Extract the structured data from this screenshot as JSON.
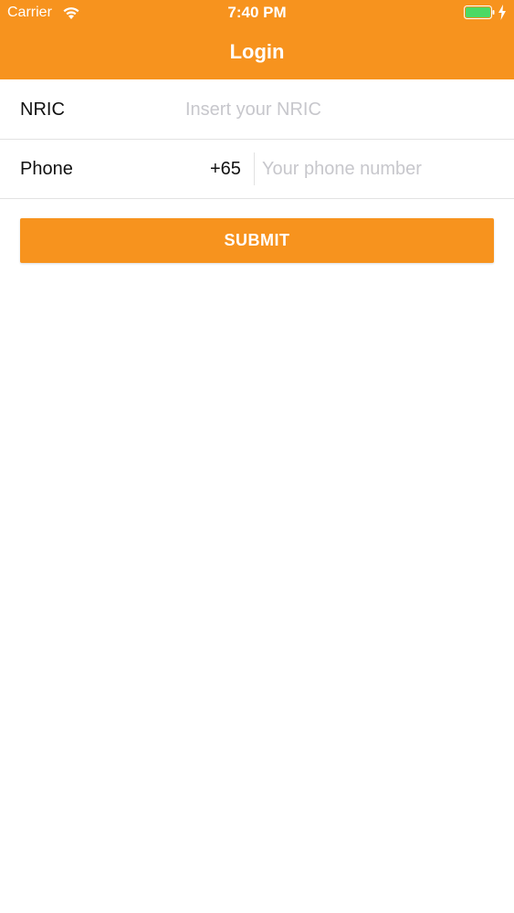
{
  "status_bar": {
    "carrier": "Carrier",
    "time": "7:40 PM",
    "icons": [
      "wifi-icon",
      "battery-icon",
      "charging-bolt-icon"
    ],
    "battery_color": "#4CD964"
  },
  "header": {
    "title": "Login",
    "background_color": "#F7931E"
  },
  "form": {
    "nric": {
      "label": "NRIC",
      "value": "",
      "placeholder": "Insert your NRIC"
    },
    "phone": {
      "label": "Phone",
      "country_code": "+65",
      "value": "",
      "placeholder": "Your phone number"
    },
    "submit_label": "SUBMIT"
  },
  "colors": {
    "accent": "#F7931E",
    "placeholder": "#C7C7CC",
    "divider": "#E2E2E2"
  }
}
